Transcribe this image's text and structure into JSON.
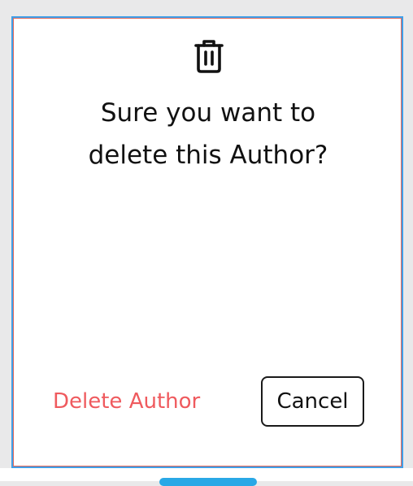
{
  "dialog": {
    "icon": "trash-icon",
    "message_line1": "Sure you want to",
    "message_line2": "delete this Author?",
    "delete_label": "Delete Author",
    "cancel_label": "Cancel"
  },
  "colors": {
    "delete_text": "#ef5a5e",
    "dialog_border": "#e36a5c",
    "focus_border": "#3f9fe8",
    "backdrop": "#e9e9ea"
  }
}
